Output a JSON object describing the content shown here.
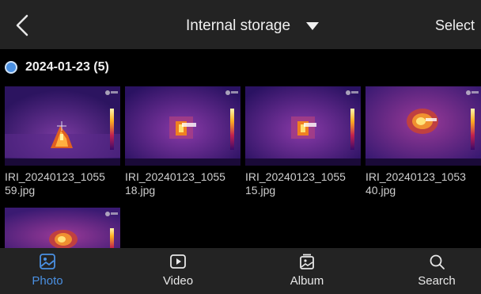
{
  "header": {
    "title": "Internal storage",
    "select_label": "Select",
    "back_icon": "chevron-left-icon",
    "dropdown_icon": "caret-down-icon"
  },
  "group": {
    "label": "2024-01-23 (5)"
  },
  "photos": [
    {
      "name": "IRI_20240123_105559.jpg",
      "caption_line1": "IRI_20240123_1055",
      "caption_line2": "59.jpg"
    },
    {
      "name": "IRI_20240123_105518.jpg",
      "caption_line1": "IRI_20240123_1055",
      "caption_line2": "18.jpg"
    },
    {
      "name": "IRI_20240123_105515.jpg",
      "caption_line1": "IRI_20240123_1055",
      "caption_line2": "15.jpg"
    },
    {
      "name": "IRI_20240123_105340.jpg",
      "caption_line1": "IRI_20240123_1053",
      "caption_line2": "40.jpg"
    },
    {
      "name": "",
      "caption_line1": "",
      "caption_line2": ""
    }
  ],
  "bottom_nav": [
    {
      "label": "Photo",
      "icon": "photo-icon",
      "active": true
    },
    {
      "label": "Video",
      "icon": "video-icon",
      "active": false
    },
    {
      "label": "Album",
      "icon": "album-icon",
      "active": false
    },
    {
      "label": "Search",
      "icon": "search-icon",
      "active": false
    }
  ],
  "colors": {
    "accent": "#4a90e2",
    "bar_bg": "#232323",
    "background": "#000000",
    "thermal_base": "#3a1a6a",
    "thermal_hot": "#ffd24a"
  }
}
